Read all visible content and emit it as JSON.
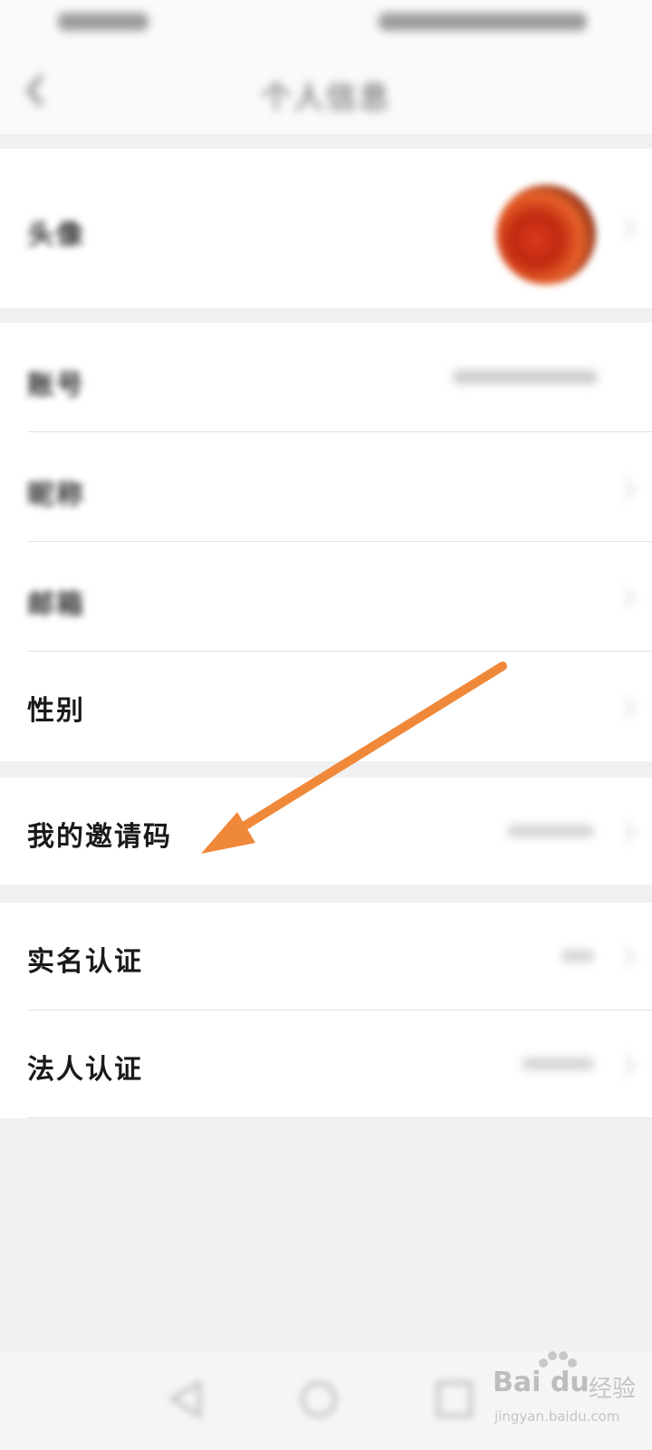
{
  "status_bar": {
    "left_text": "",
    "right_text": ""
  },
  "header": {
    "title": "个人信息"
  },
  "profile": {
    "avatar_row": {
      "label": "头像"
    }
  },
  "account_group": {
    "rows": [
      {
        "label": "账号",
        "value": ""
      },
      {
        "label": "昵称",
        "value": ""
      },
      {
        "label": "邮箱",
        "value": ""
      },
      {
        "label": "性别",
        "value": ""
      }
    ]
  },
  "invite_group": {
    "rows": [
      {
        "label": "我的邀请码",
        "value": ""
      }
    ]
  },
  "cert_group": {
    "rows": [
      {
        "label": "实名认证",
        "value": ""
      },
      {
        "label": "法人认证",
        "value": ""
      }
    ]
  },
  "annotation": {
    "arrow_color": "#f0883a"
  },
  "watermark": {
    "brand": "Bai du",
    "cn": "经验",
    "url": "jingyan.baidu.com"
  },
  "icons": {
    "back": "chevron-left-icon",
    "chevron": "chevron-right-icon",
    "nav_back": "triangle-back-icon",
    "nav_home": "circle-home-icon",
    "nav_recents": "square-recents-icon"
  }
}
